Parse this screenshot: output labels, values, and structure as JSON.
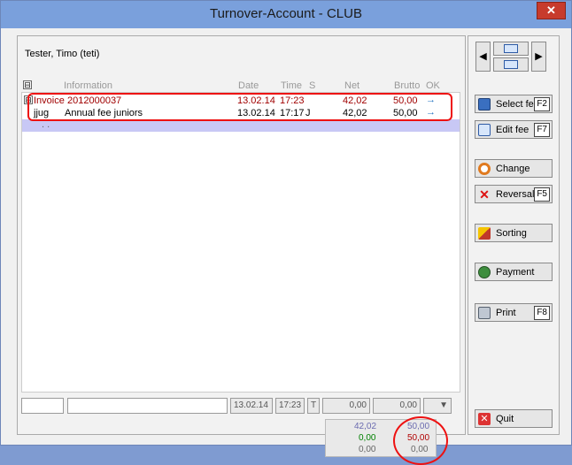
{
  "window": {
    "title": "Turnover-Account - CLUB",
    "close_glyph": "✕"
  },
  "customer": {
    "name": "Tester, Timo (teti)"
  },
  "grid": {
    "headers": {
      "expand": "⊟",
      "information": "Information",
      "date": "Date",
      "time": "Time",
      "s": "S",
      "net": "Net",
      "brutto": "Brutto",
      "ok": "OK"
    },
    "rows": [
      {
        "kind": "invoice",
        "expander": "⊟",
        "code": "Invoice",
        "information": "2012000037",
        "date": "13.02.14",
        "time": "17:23",
        "s": "",
        "net": "42,02",
        "brutto": "50,00",
        "ok": "→"
      },
      {
        "kind": "item",
        "code": "jjug",
        "information": "Annual fee juniors",
        "date": "13.02.14",
        "time": "17:17",
        "s": "J",
        "net": "42,02",
        "brutto": "50,00",
        "ok": "→"
      },
      {
        "kind": "empty",
        "code": ". .",
        "information": "",
        "date": "",
        "time": "",
        "s": "",
        "net": "",
        "brutto": "",
        "ok": ""
      }
    ]
  },
  "entry": {
    "code": "",
    "information": "",
    "date": "13.02.14",
    "time": "17:23",
    "s": "T",
    "net": "0,00",
    "brutto": "0,00",
    "dropdown_glyph": "▼"
  },
  "totals": {
    "net_1": "42,02",
    "net_2": "0,00",
    "net_3": "0,00",
    "brutto_1": "50,00",
    "brutto_2": "50,00",
    "brutto_3": "0,00"
  },
  "nav": {
    "prev_glyph": "◀",
    "next_glyph": "▶"
  },
  "actions": [
    {
      "label": "Select fee",
      "fkey": "F2",
      "icon": "select-fee-icon"
    },
    {
      "label": "Edit fee",
      "fkey": "F7",
      "icon": "edit-fee-icon"
    },
    {
      "label": "Change",
      "fkey": "",
      "icon": "change-icon"
    },
    {
      "label": "Reversal",
      "fkey": "F5",
      "icon": "reversal-icon"
    },
    {
      "label": "Sorting",
      "fkey": "",
      "icon": "sorting-icon"
    },
    {
      "label": "Payment",
      "fkey": "",
      "icon": "payment-icon"
    },
    {
      "label": "Print",
      "fkey": "F8",
      "icon": "print-icon"
    },
    {
      "label": "Quit",
      "fkey": "",
      "icon": "quit-icon"
    }
  ],
  "colors": {
    "invoice_text": "#a00000",
    "highlight_row": "#c8c8f5",
    "total_blue": "#6b6bb0",
    "total_green": "#008000",
    "total_red": "#b00000",
    "annotation_red": "#e11111"
  }
}
